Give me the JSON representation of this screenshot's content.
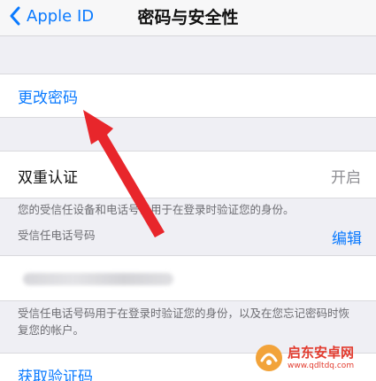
{
  "navbar": {
    "back_label": "Apple ID",
    "title": "密码与安全性"
  },
  "change_password": {
    "label": "更改密码"
  },
  "two_factor": {
    "title": "双重认证",
    "status": "开启",
    "description": "您的受信任设备和电话号码用于在登录时验证您的身份。"
  },
  "trusted_phone": {
    "header": "受信任电话号码",
    "edit_label": "编辑",
    "footer": "受信任电话号码用于在登录时验证您的身份，以及在您忘记密码时恢复您的帐户。"
  },
  "get_code": {
    "label": "获取验证码"
  },
  "watermark": {
    "name": "启东安卓网",
    "url": "www.qdltdq.com"
  },
  "colors": {
    "accent": "#0a7aff",
    "arrow": "#e8262b",
    "background": "#efeff4"
  },
  "icons": {
    "back": "chevron-left-icon",
    "annotation": "red-arrow-icon"
  }
}
